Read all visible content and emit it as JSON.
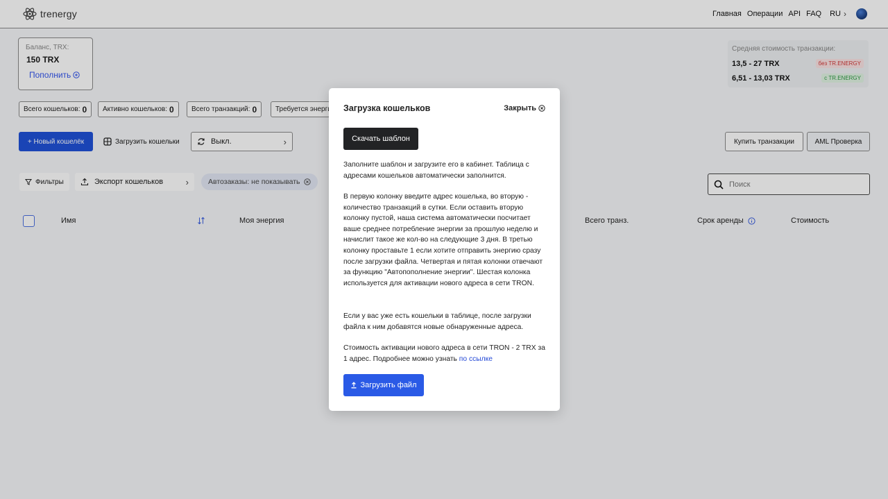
{
  "header": {
    "logo_text": "trenergy",
    "nav": [
      "Главная",
      "Операции",
      "API",
      "FAQ"
    ],
    "lang": "RU"
  },
  "balance": {
    "label": "Баланс, TRX:",
    "value": "150 TRX",
    "topup_label": "Пополнить"
  },
  "cost": {
    "title": "Средняя стоимость транзакции:",
    "without_value": "13,5 - 27 TRX",
    "without_tag": "без TR.ENERGY",
    "with_value": "6,51 - 13,03 TRX",
    "with_tag": "с TR.ENERGY"
  },
  "stats": [
    {
      "label": "Всего кошельков:",
      "value": "0"
    },
    {
      "label": "Активно кошельков:",
      "value": "0"
    },
    {
      "label": "Всего транзакций:",
      "value": "0"
    },
    {
      "label": "Требуется энерги",
      "value": ""
    }
  ],
  "actions": {
    "new_wallet": "+ Новый кошелёк",
    "upload_wallets": "Загрузить кошельки",
    "auto_toggle": "Выкл.",
    "buy_transactions": "Купить транзакции",
    "aml_check": "AML Проверка"
  },
  "filters": {
    "filters_label": "Фильтры",
    "export_label": "Экспорт кошельков",
    "autoorders_label": "Автозаказы: не показывать",
    "search_placeholder": "Поиск"
  },
  "table": {
    "columns": [
      "Имя",
      "Моя энергия",
      "Всего транз.",
      "Срок аренды",
      "Стоимость"
    ]
  },
  "modal": {
    "title": "Загрузка кошельков",
    "close_label": "Закрыть",
    "download_template": "Скачать шаблон",
    "p1": "Заполните шаблон и загрузите его в кабинет. Таблица с адресами кошельков автоматически заполнится.",
    "p2": "В первую колонку введите адрес кошелька, во вторую - количество транзакций в сутки. Если оставить вторую колонку пустой, наша система автоматически посчитает ваше среднее потребление энергии за прошлую неделю и начислит такое же кол-во на следующие 3 дня. В третью колонку проставьте 1 если хотите отправить энергию сразу после загрузки файла. Четвертая и пятая колонки отвечают за функцию \"Автопополнение энергии\". Шестая колонка используется для активации нового адреса в сети TRON.",
    "p3": "Если у вас уже есть кошельки в таблице, после загрузки файла к ним добавятся новые обнаруженные адреса.",
    "p4": "Стоимость активации нового адреса в сети TRON - 2 TRX за 1 адрес. Подробнее можно узнать",
    "p4_link": "по ссылке",
    "upload_file": "Загрузить файл"
  },
  "colors": {
    "primary": "#1f52d8",
    "dark_button": "#222325",
    "link": "#2348d6"
  }
}
